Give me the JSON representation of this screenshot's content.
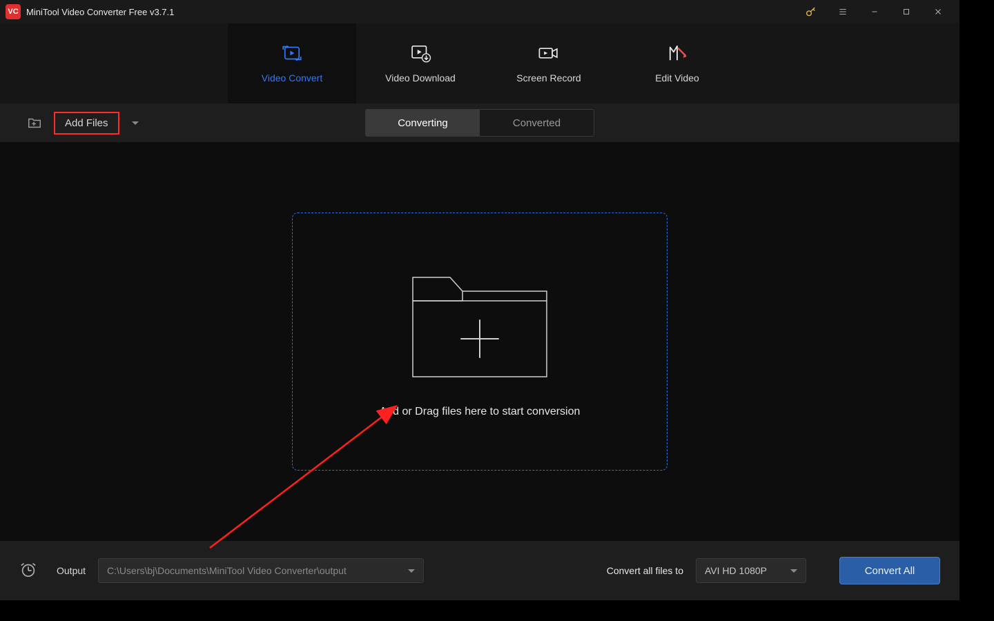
{
  "titlebar": {
    "app_icon_text": "VC",
    "title": "MiniTool Video Converter Free v3.7.1"
  },
  "topnav": {
    "tabs": [
      {
        "label": "Video Convert",
        "icon": "convert-icon",
        "active": true
      },
      {
        "label": "Video Download",
        "icon": "download-icon",
        "active": false
      },
      {
        "label": "Screen Record",
        "icon": "record-icon",
        "active": false
      },
      {
        "label": "Edit Video",
        "icon": "edit-icon",
        "active": false
      }
    ]
  },
  "toolbar": {
    "add_files_label": "Add Files",
    "subtabs": {
      "converting": "Converting",
      "converted": "Converted"
    }
  },
  "dropzone": {
    "text": "Add or Drag files here to start conversion"
  },
  "bottombar": {
    "output_label": "Output",
    "output_path": "C:\\Users\\bj\\Documents\\MiniTool Video Converter\\output",
    "convert_all_label": "Convert all files to",
    "format_selected": "AVI HD 1080P",
    "convert_all_button": "Convert All"
  },
  "annotation": {
    "highlight_target": "add-files-button",
    "arrow_color": "#ff2020"
  }
}
